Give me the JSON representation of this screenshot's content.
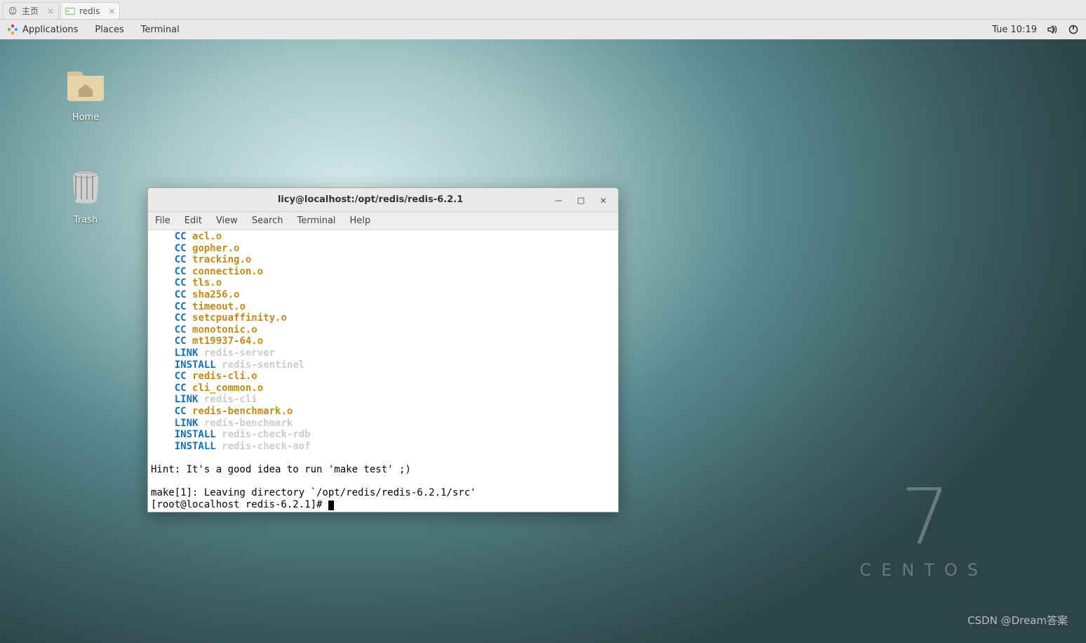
{
  "browser_tabs": [
    {
      "label": "主页",
      "icon": "globe"
    },
    {
      "label": "redis",
      "icon": "xterm"
    }
  ],
  "topbar": {
    "apps": "Applications",
    "places": "Places",
    "terminal": "Terminal",
    "clock": "Tue 10:19"
  },
  "desktop": {
    "home": "Home",
    "trash": "Trash"
  },
  "window": {
    "title": "licy@localhost:/opt/redis/redis-6.2.1",
    "menu": [
      "File",
      "Edit",
      "View",
      "Search",
      "Terminal",
      "Help"
    ]
  },
  "term_lines": [
    {
      "indent": "    ",
      "cmd": "CC",
      "arg": "acl.o",
      "ac": "orange"
    },
    {
      "indent": "    ",
      "cmd": "CC",
      "arg": "gopher.o",
      "ac": "orange"
    },
    {
      "indent": "    ",
      "cmd": "CC",
      "arg": "tracking.o",
      "ac": "orange"
    },
    {
      "indent": "    ",
      "cmd": "CC",
      "arg": "connection.o",
      "ac": "orange"
    },
    {
      "indent": "    ",
      "cmd": "CC",
      "arg": "tls.o",
      "ac": "orange"
    },
    {
      "indent": "    ",
      "cmd": "CC",
      "arg": "sha256.o",
      "ac": "orange"
    },
    {
      "indent": "    ",
      "cmd": "CC",
      "arg": "timeout.o",
      "ac": "orange"
    },
    {
      "indent": "    ",
      "cmd": "CC",
      "arg": "setcpuaffinity.o",
      "ac": "orange"
    },
    {
      "indent": "    ",
      "cmd": "CC",
      "arg": "monotonic.o",
      "ac": "orange"
    },
    {
      "indent": "    ",
      "cmd": "CC",
      "arg": "mt19937-64.o",
      "ac": "orange"
    },
    {
      "indent": "    ",
      "cmd": "LINK",
      "arg": "redis-server",
      "ac": "grey"
    },
    {
      "indent": "    ",
      "cmd": "INSTALL",
      "arg": "redis-sentinel",
      "ac": "grey"
    },
    {
      "indent": "    ",
      "cmd": "CC",
      "arg": "redis-cli.o",
      "ac": "orange"
    },
    {
      "indent": "    ",
      "cmd": "CC",
      "arg": "cli_common.o",
      "ac": "orange"
    },
    {
      "indent": "    ",
      "cmd": "LINK",
      "arg": "redis-cli",
      "ac": "grey"
    },
    {
      "indent": "    ",
      "cmd": "CC",
      "arg": "redis-benchmark.o",
      "ac": "orange"
    },
    {
      "indent": "    ",
      "cmd": "LINK",
      "arg": "redis-benchmark",
      "ac": "grey"
    },
    {
      "indent": "    ",
      "cmd": "INSTALL",
      "arg": "redis-check-rdb",
      "ac": "grey"
    },
    {
      "indent": "    ",
      "cmd": "INSTALL",
      "arg": "redis-check-aof",
      "ac": "grey"
    }
  ],
  "term_tail": {
    "hint": "Hint: It's a good idea to run 'make test' ;)",
    "leave": "make[1]: Leaving directory `/opt/redis/redis-6.2.1/src'",
    "prompt": "[root@localhost redis-6.2.1]# "
  },
  "brand": {
    "seven": "7",
    "name": "CENTOS"
  },
  "watermark": "CSDN @Dream答案"
}
